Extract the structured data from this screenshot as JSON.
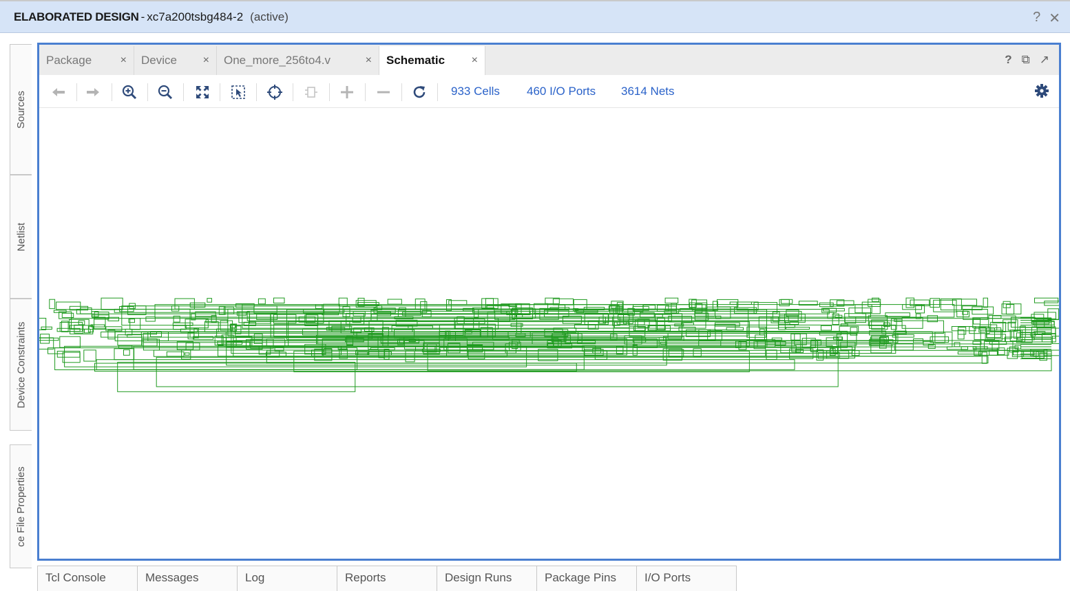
{
  "header": {
    "title": "ELABORATED DESIGN",
    "separator": "-",
    "part": "xc7a200tsbg484-2",
    "state": "(active)",
    "help": "?",
    "close": "✕"
  },
  "left_tabs": [
    "Sources",
    "Netlist",
    "Device Constraints",
    "ce File Properties"
  ],
  "tabs": [
    {
      "label": "Package",
      "close": "×"
    },
    {
      "label": "Device",
      "close": "×"
    },
    {
      "label": "One_more_256to4.v",
      "close": "×"
    },
    {
      "label": "Schematic",
      "close": "×",
      "active": true
    }
  ],
  "tab_controls": {
    "help": "?",
    "restore": "⧉",
    "float": "↗"
  },
  "toolbar": {
    "icons": [
      "back-icon",
      "forward-icon",
      "zoom-in-icon",
      "zoom-out-icon",
      "zoom-fit-icon",
      "zoom-area-icon",
      "select-area-icon",
      "instance-icon",
      "expand-icon",
      "collapse-icon",
      "refresh-icon"
    ],
    "stats": {
      "cells": "933 Cells",
      "ports": "460 I/O Ports",
      "nets": "3614 Nets"
    }
  },
  "bottom_tabs": [
    "Tcl Console",
    "Messages",
    "Log",
    "Reports",
    "Design Runs",
    "Package Pins",
    "I/O Ports"
  ],
  "colors": {
    "accent": "#4a7fd0",
    "header_bg": "#d6e4f7",
    "link": "#2a62c9",
    "schematic": "#1e9a1e"
  }
}
